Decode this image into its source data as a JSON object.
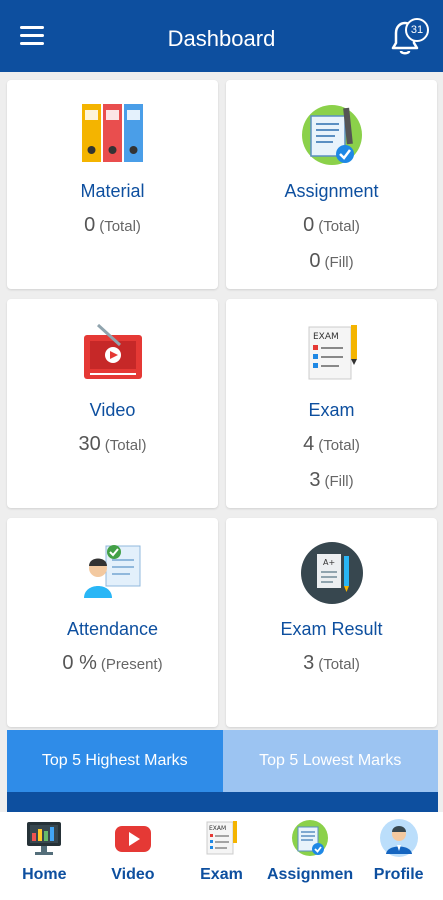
{
  "header": {
    "title": "Dashboard",
    "notification_count": "31"
  },
  "cards": [
    {
      "label": "Material",
      "stats": [
        {
          "value": "0",
          "unit": "(Total)"
        }
      ]
    },
    {
      "label": "Assignment",
      "stats": [
        {
          "value": "0",
          "unit": "(Total)"
        },
        {
          "value": "0",
          "unit": "(Fill)"
        }
      ]
    },
    {
      "label": "Video",
      "stats": [
        {
          "value": "30",
          "unit": "(Total)"
        }
      ]
    },
    {
      "label": "Exam",
      "stats": [
        {
          "value": "4",
          "unit": "(Total)"
        },
        {
          "value": "3",
          "unit": "(Fill)"
        }
      ]
    },
    {
      "label": "Attendance",
      "stats": [
        {
          "value": "0 %",
          "unit": "(Present)"
        }
      ]
    },
    {
      "label": "Exam Result",
      "stats": [
        {
          "value": "3",
          "unit": "(Total)"
        }
      ]
    }
  ],
  "tabs": [
    {
      "label": "Top 5 Highest Marks",
      "active": true
    },
    {
      "label": "Top 5 Lowest Marks",
      "active": false
    }
  ],
  "bottom_nav": [
    {
      "label": "Home",
      "icon": "monitor-icon"
    },
    {
      "label": "Video",
      "icon": "youtube-play-icon"
    },
    {
      "label": "Exam",
      "icon": "exam-sheet-icon"
    },
    {
      "label": "Assignmen",
      "icon": "assignment-icon"
    },
    {
      "label": "Profile",
      "icon": "user-avatar-icon"
    }
  ],
  "colors": {
    "primary": "#0d4f9f",
    "tab_active": "#2f8ce8",
    "tab_inactive": "#9cc4f2"
  }
}
